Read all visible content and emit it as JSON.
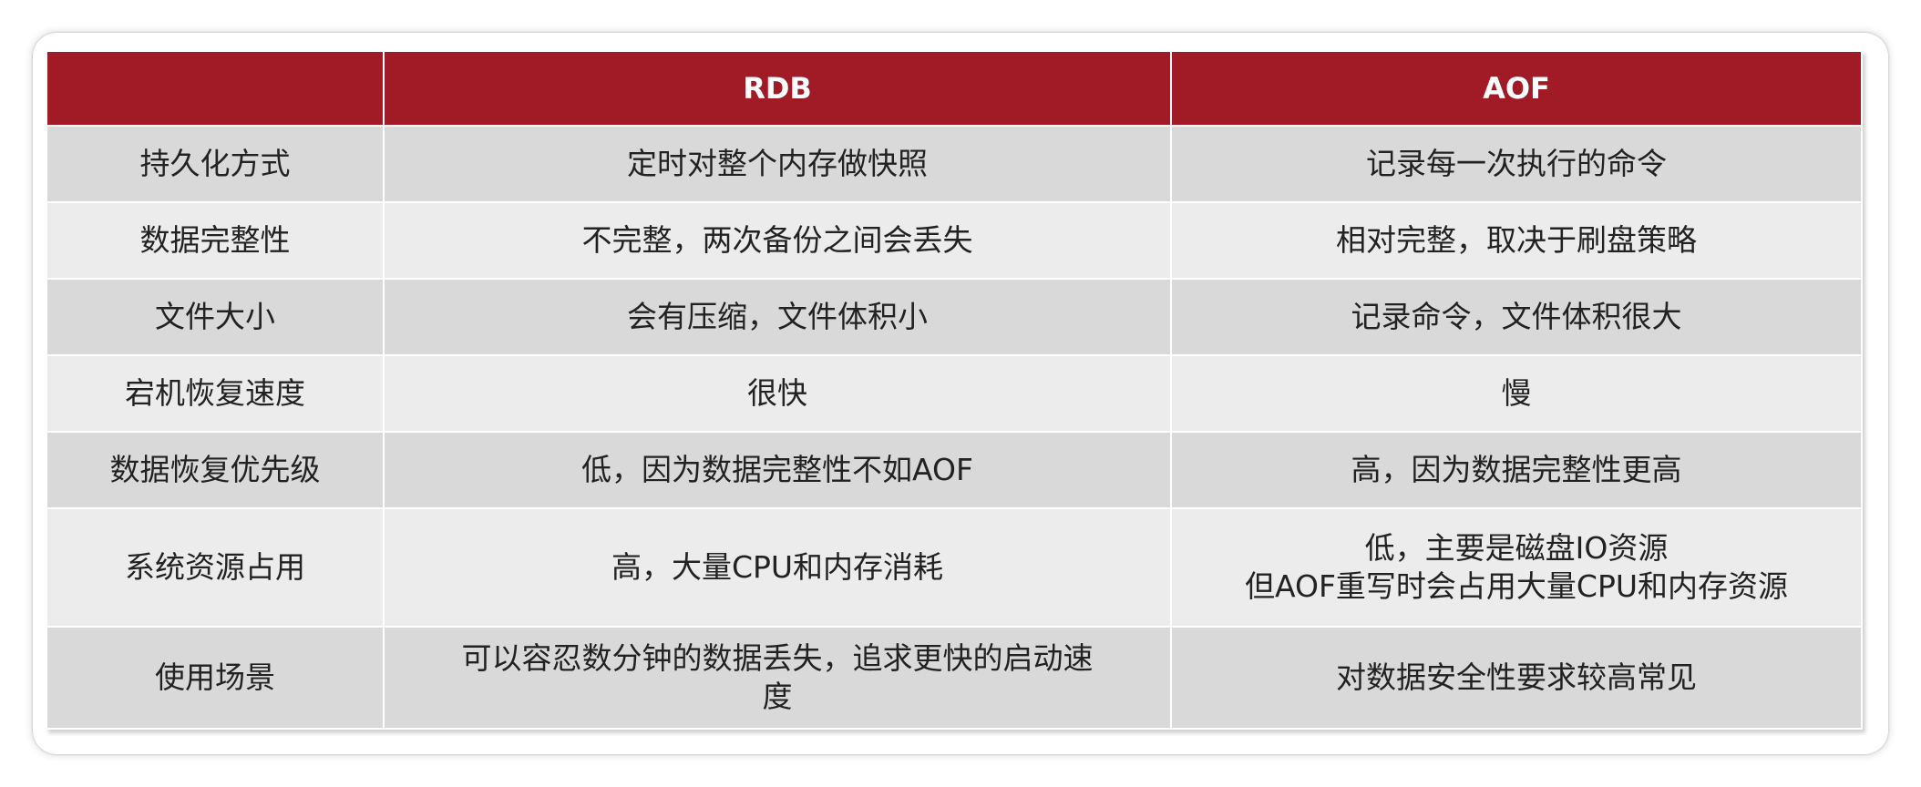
{
  "table": {
    "headers": [
      "",
      "RDB",
      "AOF"
    ],
    "rows": [
      {
        "label": "持久化方式",
        "rdb": [
          "定时对整个内存做快照"
        ],
        "aof": [
          "记录每一次执行的命令"
        ]
      },
      {
        "label": "数据完整性",
        "rdb": [
          "不完整，两次备份之间会丢失"
        ],
        "aof": [
          "相对完整，取决于刷盘策略"
        ]
      },
      {
        "label": "文件大小",
        "rdb": [
          "会有压缩，文件体积小"
        ],
        "aof": [
          "记录命令，文件体积很大"
        ]
      },
      {
        "label": "宕机恢复速度",
        "rdb": [
          "很快"
        ],
        "aof": [
          "慢"
        ]
      },
      {
        "label": "数据恢复优先级",
        "rdb": [
          "低，因为数据完整性不如AOF"
        ],
        "aof": [
          "高，因为数据完整性更高"
        ]
      },
      {
        "label": "系统资源占用",
        "rdb": [
          "高，大量CPU和内存消耗"
        ],
        "aof": [
          "低，主要是磁盘IO资源",
          "但AOF重写时会占用大量CPU和内存资源"
        ]
      },
      {
        "label": "使用场景",
        "rdb": [
          "可以容忍数分钟的数据丢失，追求更快的启动速",
          "度"
        ],
        "aof": [
          "对数据安全性要求较高常见"
        ]
      }
    ]
  },
  "colors": {
    "header_bg": "#a11b26",
    "header_text": "#ffffff",
    "row_odd": "#d9d9d9",
    "row_even": "#ececec"
  }
}
